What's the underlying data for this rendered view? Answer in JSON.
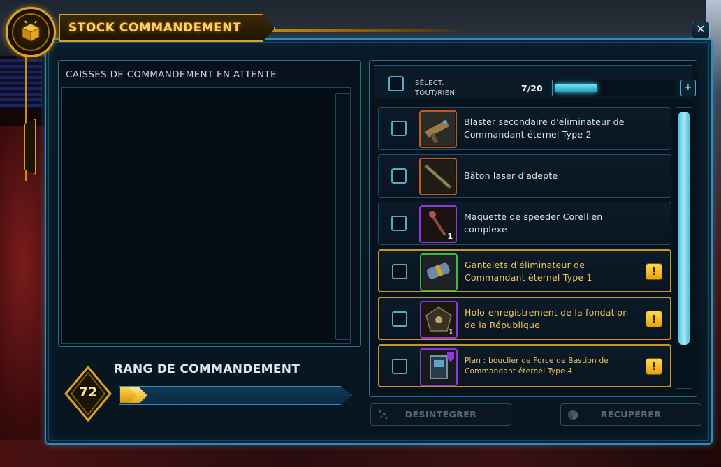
{
  "window": {
    "title": "STOCK COMMANDEMENT",
    "close_label": "✕"
  },
  "left_panel": {
    "title": "CAISSES DE COMMANDEMENT EN ATTENTE"
  },
  "command_rank": {
    "title": "RANG DE COMMANDEMENT",
    "level": "72",
    "progress_fraction": 0.1
  },
  "inventory": {
    "select_all_label_line1": "SÉLECT.",
    "select_all_label_line2": "TOUT/RIEN",
    "count": "7/20",
    "capacity_fraction": 0.35,
    "expand_label": "+"
  },
  "items": [
    {
      "name": "Blaster secondaire d'éliminateur de Commandant éternel Type 2",
      "quality": "orange",
      "qty": "",
      "alert": false,
      "icon": "blaster-icon"
    },
    {
      "name": "Bâton laser d'adepte",
      "quality": "orange",
      "qty": "",
      "alert": false,
      "icon": "staff-icon"
    },
    {
      "name": "Maquette de speeder Corellien complexe",
      "quality": "purple",
      "qty": "1",
      "alert": false,
      "icon": "speeder-model-icon"
    },
    {
      "name": "Gantelets d'éliminateur de Commandant éternel Type 1",
      "quality": "green",
      "qty": "",
      "alert": true,
      "icon": "gauntlet-icon"
    },
    {
      "name": "Holo-enregistrement de la fondation de la République",
      "quality": "purple",
      "qty": "1",
      "alert": true,
      "icon": "holocron-icon"
    },
    {
      "name": "Plan : bouclier de Force de Bastion de Commandant éternel Type 4",
      "quality": "purple",
      "qty": "",
      "alert": true,
      "icon": "schematic-icon"
    }
  ],
  "warning_glyph": "!",
  "actions": {
    "disintegrate_label": "DÉSINTÉGRER",
    "retrieve_label": "RÉCUPÉRER"
  },
  "colors": {
    "accent_gold": "#d8a11f",
    "accent_blue": "#2b8fb8",
    "quality_orange": "#c15a1e",
    "quality_purple": "#8a3ad8",
    "quality_green": "#36c03c"
  }
}
